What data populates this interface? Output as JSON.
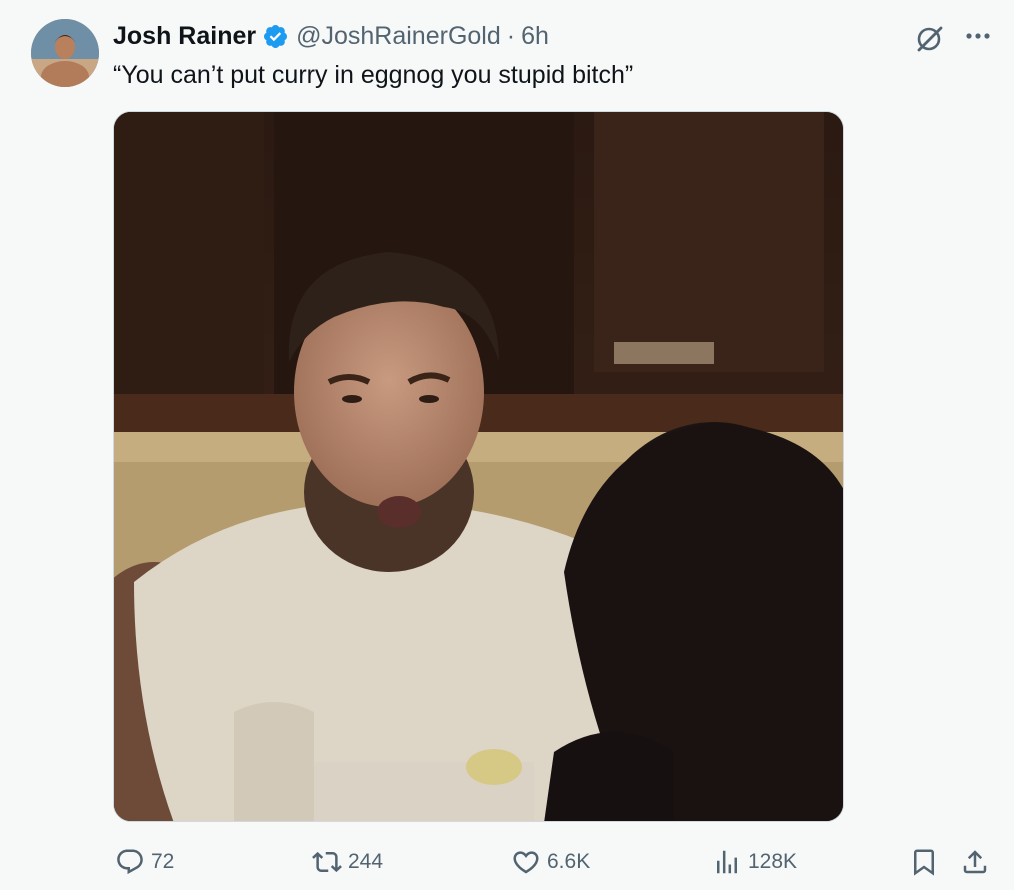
{
  "tweet": {
    "author_name": "Josh Rainer",
    "handle": "@JoshRainerGold",
    "separator": "·",
    "time": "6h",
    "text": "“You can’t put curry in eggnog you stupid bitch”"
  },
  "icons": {
    "verified": "verified-badge-icon",
    "grok": "grok-icon",
    "more": "more-options-icon",
    "reply": "reply-icon",
    "retweet": "retweet-icon",
    "like": "like-icon",
    "views": "views-icon",
    "bookmark": "bookmark-icon",
    "share": "share-icon"
  },
  "stats": {
    "replies": "72",
    "retweets": "244",
    "likes": "6.6K",
    "views": "128K"
  },
  "colors": {
    "text": "#0f1419",
    "secondary": "#536471",
    "verified": "#1d9bf0",
    "background": "#f7f9f9"
  }
}
